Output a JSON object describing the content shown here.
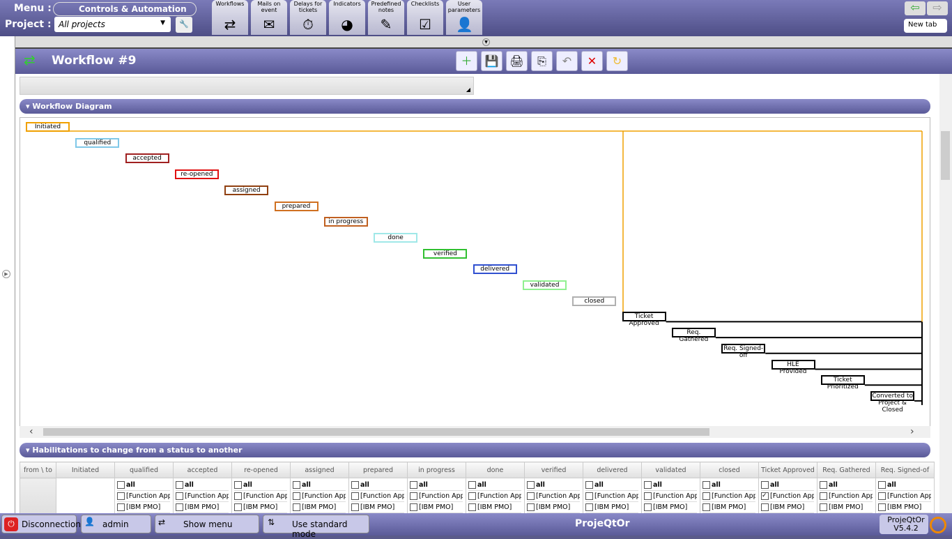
{
  "header": {
    "menu_label": "Menu :",
    "menu_value": "Controls & Automation",
    "project_label": "Project :",
    "project_value": "All projects",
    "new_tab": "New tab",
    "tabs": [
      {
        "label": "Workflows",
        "icon": "workflow-icon"
      },
      {
        "label": "Mails on event",
        "icon": "mail-icon"
      },
      {
        "label": "Delays for tickets",
        "icon": "stopwatch-icon"
      },
      {
        "label": "Indicators",
        "icon": "pie-icon"
      },
      {
        "label": "Predefined notes",
        "icon": "note-icon"
      },
      {
        "label": "Checklists",
        "icon": "checklist-icon"
      },
      {
        "label": "User parameters",
        "icon": "user-settings-icon"
      }
    ]
  },
  "title": "Workflow  #9",
  "sections": {
    "diagram": "Workflow Diagram",
    "habilitations": "Habilitations to change from a status to another"
  },
  "statuses": [
    {
      "name": "Initiated",
      "color": "#f0a000"
    },
    {
      "name": "qualified",
      "color": "#80c8e8"
    },
    {
      "name": "accepted",
      "color": "#a02020"
    },
    {
      "name": "re-opened",
      "color": "#e01010"
    },
    {
      "name": "assigned",
      "color": "#904010"
    },
    {
      "name": "prepared",
      "color": "#d07020"
    },
    {
      "name": "in progress",
      "color": "#c06020"
    },
    {
      "name": "done",
      "color": "#a0e8e8"
    },
    {
      "name": "verified",
      "color": "#30c030"
    },
    {
      "name": "delivered",
      "color": "#3050d0"
    },
    {
      "name": "validated",
      "color": "#90f090"
    },
    {
      "name": "closed",
      "color": "#b0b0b0"
    },
    {
      "name": "Ticket Approved",
      "color": "#000000"
    },
    {
      "name": "Req. Gathered",
      "color": "#000000"
    },
    {
      "name": "Req. Signed-off",
      "color": "#000000"
    },
    {
      "name": "HLE Provided",
      "color": "#000000"
    },
    {
      "name": "Ticket Prioritized",
      "color": "#000000"
    },
    {
      "name": "Converted to Project & Closed",
      "color": "#000000"
    }
  ],
  "table": {
    "corner": "from \\ to",
    "columns": [
      "Initiated",
      "qualified",
      "accepted",
      "re-opened",
      "assigned",
      "prepared",
      "in progress",
      "done",
      "verified",
      "delivered",
      "validated",
      "closed",
      "Ticket Approved",
      "Req. Gathered",
      "Req. Signed-of"
    ],
    "options": [
      "all",
      "[Function App",
      "[IBM PMO]"
    ],
    "checked_column": "Ticket Approved",
    "checked_option": "[Function App"
  },
  "footer": {
    "disconnect": "Disconnection",
    "user": "admin",
    "show_menu": "Show menu",
    "mode": "Use standard mode",
    "brand": "ProjeQtOr",
    "app": "ProjeQtOr",
    "version": "V5.4.2"
  }
}
